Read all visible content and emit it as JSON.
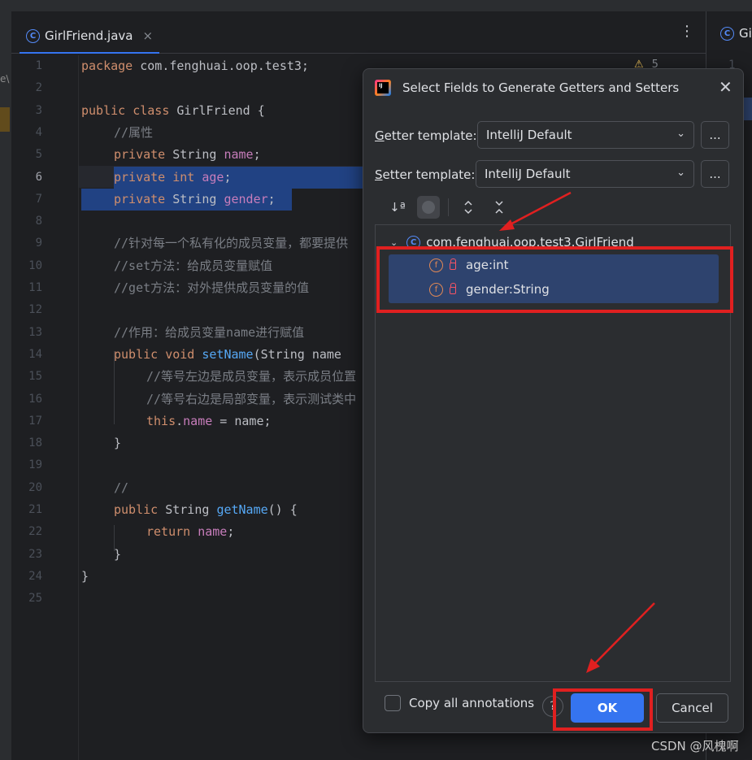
{
  "editor": {
    "tab": {
      "label": "GirlFriend.java",
      "close": "×"
    },
    "kebab": "⋮",
    "right_tab_label": "Gi",
    "right_gutter_num": "1",
    "left_strip_text": "e\\",
    "problems": {
      "warning_icon": "warning-triangle-icon",
      "count": "5"
    },
    "line_numbers": [
      "1",
      "2",
      "3",
      "4",
      "5",
      "6",
      "7",
      "8",
      "9",
      "10",
      "11",
      "12",
      "13",
      "14",
      "15",
      "16",
      "17",
      "18",
      "19",
      "20",
      "21",
      "22",
      "23",
      "24",
      "25"
    ],
    "code": {
      "l1": {
        "kw": "package",
        "rest": " com.fenghuai.oop.test3;"
      },
      "l3": {
        "kw1": "public",
        "kw2": "class",
        "name": "GirlFriend",
        "brace": " {"
      },
      "l4": "//属性",
      "l5": {
        "kw": "private",
        "type": "String",
        "field": "name",
        "end": ";"
      },
      "l6": {
        "kw": "private",
        "type": "int",
        "field": "age",
        "end": ";"
      },
      "l7": {
        "kw": "private",
        "type": "String",
        "field": "gender",
        "end": ";"
      },
      "l9": "//针对每一个私有化的成员变量，都要提供",
      "l10": "//set方法：给成员变量赋值",
      "l11": "//get方法：对外提供成员变量的值",
      "l13": "//作用：给成员变量name进行赋值",
      "l14": {
        "kw": "public",
        "kw2": "void",
        "fn": "setName",
        "rest": "(String name"
      },
      "l15": "//等号左边是成员变量，表示成员位置",
      "l16": "//等号右边是局部变量，表示测试类中",
      "l17": {
        "kw": "this",
        "dot": ".",
        "field": "name",
        "rest": " = name;"
      },
      "l18": "}",
      "l20": "//",
      "l21": {
        "kw": "public",
        "type": "String",
        "fn": "getName",
        "rest": "() {"
      },
      "l22": {
        "kw": "return",
        "field": "name",
        "end": ";"
      },
      "l23": "}",
      "l24": "}"
    }
  },
  "dialog": {
    "title": "Select Fields to Generate Getters and Setters",
    "close": "✕",
    "getter": {
      "label_u": "G",
      "label_rest": "etter template:",
      "value": "IntelliJ Default",
      "more": "..."
    },
    "setter": {
      "label_u": "S",
      "label_rest": "etter template:",
      "value": "IntelliJ Default",
      "more": "..."
    },
    "toolbar": {
      "sort": "↓ª",
      "expand": "⌃",
      "collapse": "⌄"
    },
    "tree": {
      "root": "com.fenghuai.oop.test3.GirlFriend",
      "fields": [
        "age:int",
        "gender:String"
      ]
    },
    "copy_annotations": "Copy all annotations",
    "help": "?",
    "ok": "OK",
    "cancel": "Cancel"
  },
  "watermark": "CSDN @风槐啊",
  "colors": {
    "accent": "#3574f0",
    "annotation_red": "#e02020",
    "selection": "#214283"
  }
}
